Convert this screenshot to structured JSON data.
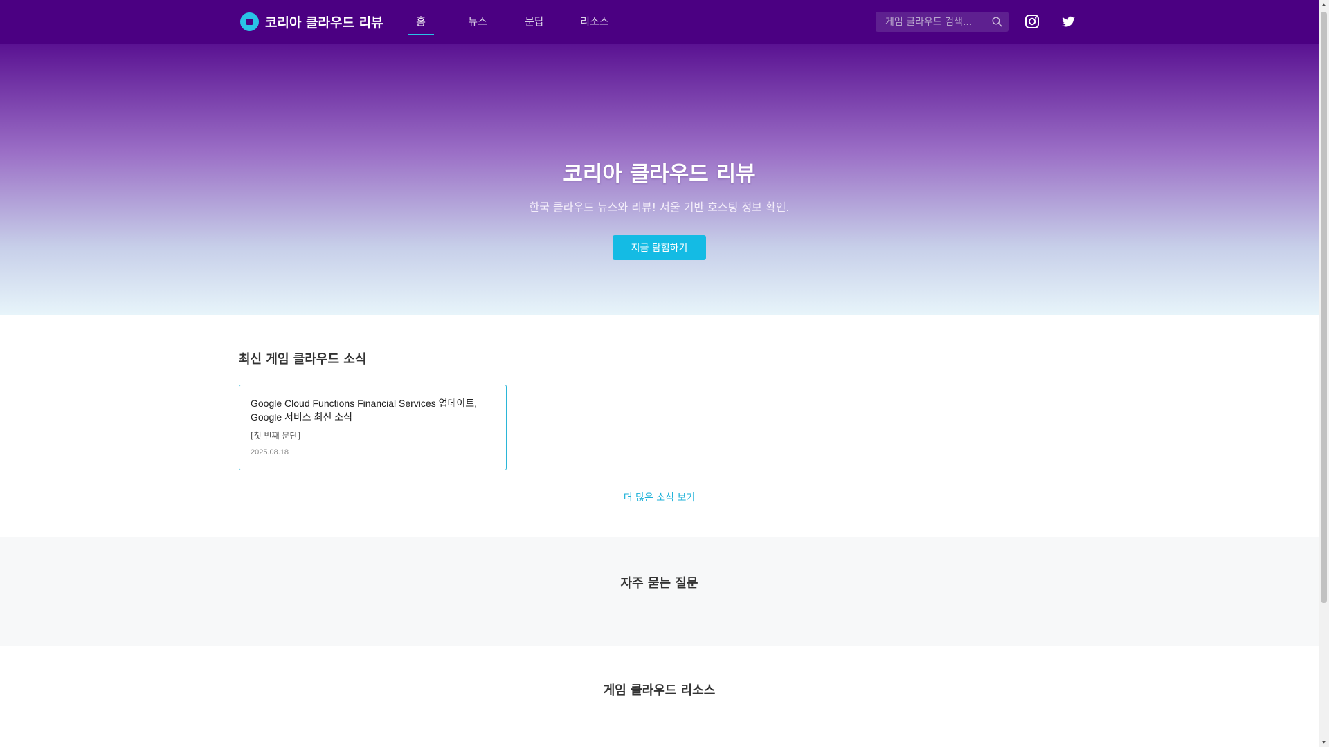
{
  "header": {
    "logo_text": "코리아 클라우드 리뷰",
    "nav": [
      {
        "label": "홈",
        "active": true
      },
      {
        "label": "뉴스",
        "active": false
      },
      {
        "label": "문답",
        "active": false
      },
      {
        "label": "리소스",
        "active": false
      }
    ],
    "search_placeholder": "게임 클라우드 검색...",
    "social_icons": [
      "instagram-icon",
      "twitter-icon"
    ]
  },
  "hero": {
    "title": "코리아 클라우드 리뷰",
    "subtitle": "한국 클라우드 뉴스와 리뷰! 서울 기반 호스팅 정보 확인.",
    "cta_label": "지금 탐험하기"
  },
  "news": {
    "title": "최신 게임 클라우드 소식",
    "cards": [
      {
        "title": "Google Cloud Functions Financial Services 업데이트, Google 서비스 최신 소식",
        "excerpt": "[첫 번째 문단]",
        "date": "2025.08.18"
      }
    ],
    "more_label": "더 많은 소식 보기"
  },
  "faq": {
    "title": "자주 묻는 질문"
  },
  "resources": {
    "title": "게임 클라우드 리소스"
  },
  "colors": {
    "header_bg": "#4b0082",
    "accent": "#14bbe4",
    "hero_gradient_top": "#5a1292",
    "hero_gradient_bottom": "#e7f4fa"
  }
}
